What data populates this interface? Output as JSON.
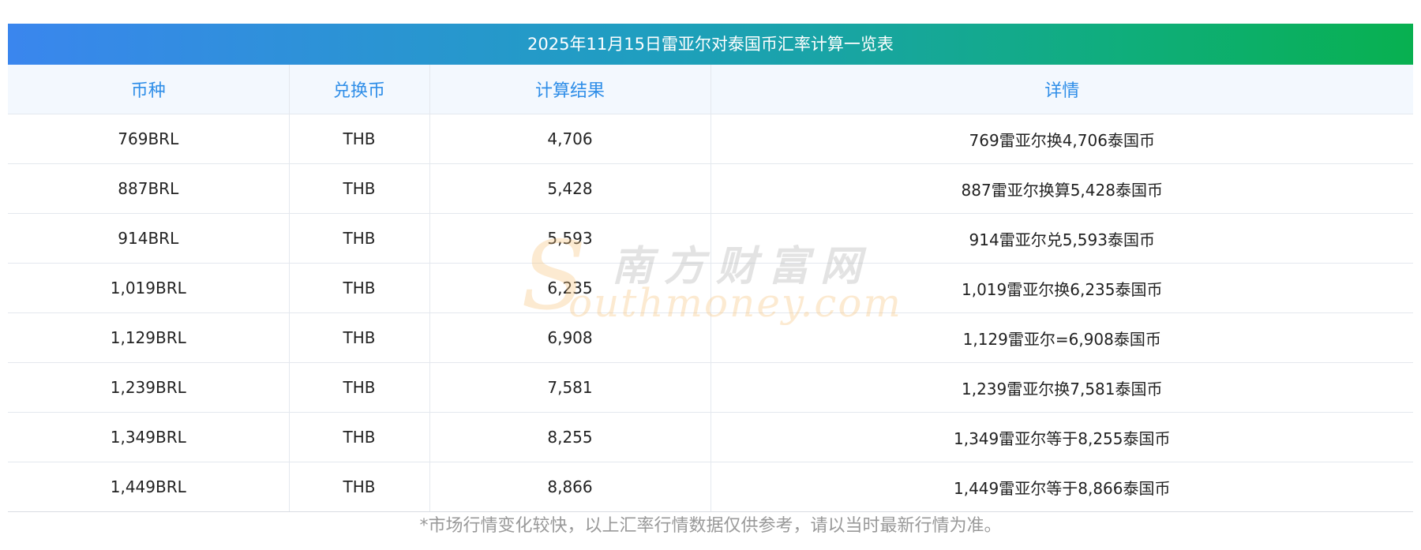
{
  "title": "2025年11月15日雷亚尔对泰国币汇率计算一览表",
  "headers": [
    "币种",
    "兑换币",
    "计算结果",
    "详情"
  ],
  "rows": [
    {
      "currency": "769BRL",
      "target": "THB",
      "result": "4,706",
      "detail": "769雷亚尔换4,706泰国币"
    },
    {
      "currency": "887BRL",
      "target": "THB",
      "result": "5,428",
      "detail": "887雷亚尔换算5,428泰国币"
    },
    {
      "currency": "914BRL",
      "target": "THB",
      "result": "5,593",
      "detail": "914雷亚尔兑5,593泰国币"
    },
    {
      "currency": "1,019BRL",
      "target": "THB",
      "result": "6,235",
      "detail": "1,019雷亚尔换6,235泰国币"
    },
    {
      "currency": "1,129BRL",
      "target": "THB",
      "result": "6,908",
      "detail": "1,129雷亚尔=6,908泰国币"
    },
    {
      "currency": "1,239BRL",
      "target": "THB",
      "result": "7,581",
      "detail": "1,239雷亚尔换7,581泰国币"
    },
    {
      "currency": "1,349BRL",
      "target": "THB",
      "result": "8,255",
      "detail": "1,349雷亚尔等于8,255泰国币"
    },
    {
      "currency": "1,449BRL",
      "target": "THB",
      "result": "8,866",
      "detail": "1,449雷亚尔等于8,866泰国币"
    }
  ],
  "watermark": {
    "cn": "南方财富网",
    "en": "outhmoney.com",
    "s_glyph": "S"
  },
  "footnote": "*市场行情变化较快，以上汇率行情数据仅供参考，请以当时最新行情为准。",
  "colors": {
    "header_text": "#2f8ee8",
    "header_bg": "#f3f8fe",
    "title_gradient_start": "#3a86ee",
    "title_gradient_end": "#08b050"
  }
}
